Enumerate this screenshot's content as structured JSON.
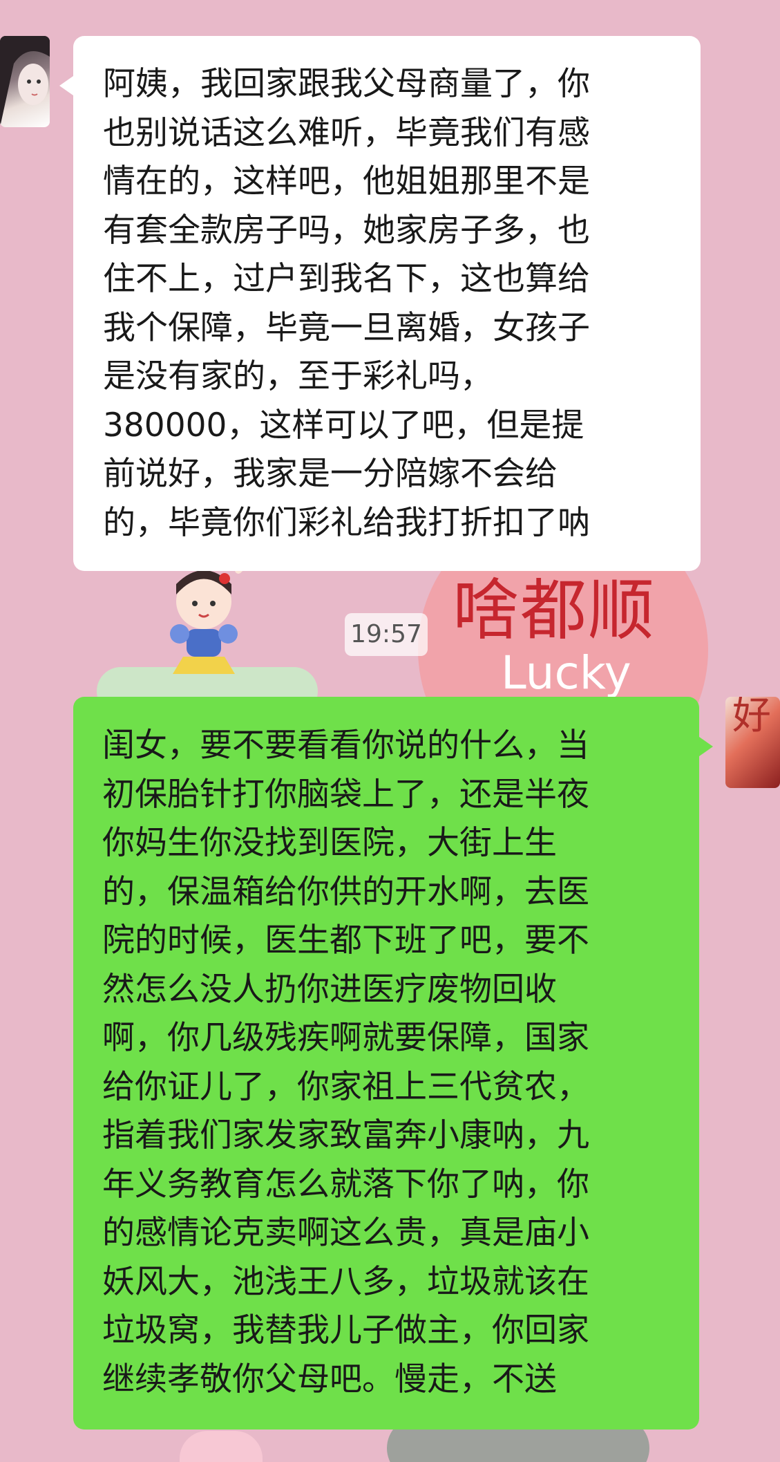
{
  "chat": {
    "timestamp": "19:57",
    "messages": [
      {
        "side": "received",
        "text": "阿姨，我回家跟我父母商量了，你\n也别说话这么难听，毕竟我们有感\n情在的，这样吧，他姐姐那里不是\n有套全款房子吗，她家房子多，也\n住不上，过户到我名下，这也算给\n我个保障，毕竟一旦离婚，女孩子\n是没有家的，至于彩礼吗，\n380000，这样可以了吧，但是提\n前说好，我家是一分陪嫁不会给\n的，毕竟你们彩礼给我打折扣了呐"
      },
      {
        "side": "sent",
        "text": "闺女，要不要看看你说的什么，当\n初保胎针打你脑袋上了，还是半夜\n你妈生你没找到医院，大街上生\n的，保温箱给你供的开水啊，去医\n院的时候，医生都下班了吧，要不\n然怎么没人扔你进医疗废物回收\n啊，你几级残疾啊就要保障，国家\n给你证儿了，你家祖上三代贫农，\n指着我们家发家致富奔小康呐，九\n年义务教育怎么就落下你了呐，你\n的感情论克卖啊这么贵，真是庙小\n妖风大，池浅王八多，垃圾就该在\n垃圾窝，我替我儿子做主，你回家\n继续孝敬你父母吧。慢走，不送"
      }
    ]
  },
  "wallpaper": {
    "sticker_text": "啥都顺",
    "sticker_subtext": "Lucky",
    "right_avatar_char": "好"
  },
  "colors": {
    "background": "#e8b9c9",
    "received_bubble": "#ffffff",
    "sent_bubble": "#6fe04a",
    "text": "#191919"
  }
}
